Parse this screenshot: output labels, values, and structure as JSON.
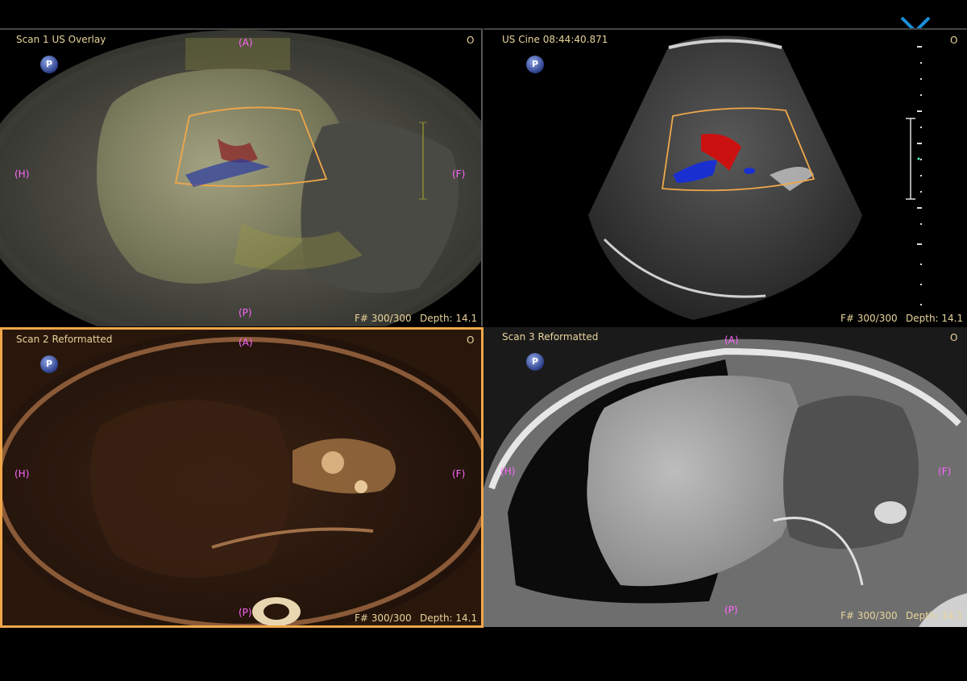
{
  "colors": {
    "label": "#e8d49a",
    "orientation": "#ff66ff",
    "active_border": "#f0a74a",
    "close": "#1a8fd6"
  },
  "viewports": [
    {
      "title": "Scan 1 US Overlay",
      "frame": "F# 300/300",
      "depth": "Depth: 14.1",
      "corner": "O",
      "badge": "P",
      "orient": {
        "top": "(A)",
        "left": "(H)",
        "right": "(F)",
        "bottom": "(P)"
      }
    },
    {
      "title": "US  Cine 08:44:40.871",
      "frame": "F# 300/300",
      "depth": "Depth: 14.1",
      "corner": "O",
      "badge": "P"
    },
    {
      "title": "Scan 2 Reformatted",
      "frame": "F# 300/300",
      "depth": "Depth: 14.1",
      "corner": "O",
      "badge": "P",
      "orient": {
        "top": "(A)",
        "left": "(H)",
        "right": "(F)",
        "bottom": "(P)"
      }
    },
    {
      "title": "Scan 3 Reformatted",
      "frame": "F# 300/300",
      "depth": "Depth: 14.1",
      "corner": "O",
      "badge": "P",
      "orient": {
        "top": "(A)",
        "left": "(H)",
        "right": "(F)",
        "bottom": "(P)"
      }
    }
  ],
  "icons": {
    "close": "close-x-icon",
    "badge": "p-badge-icon"
  }
}
